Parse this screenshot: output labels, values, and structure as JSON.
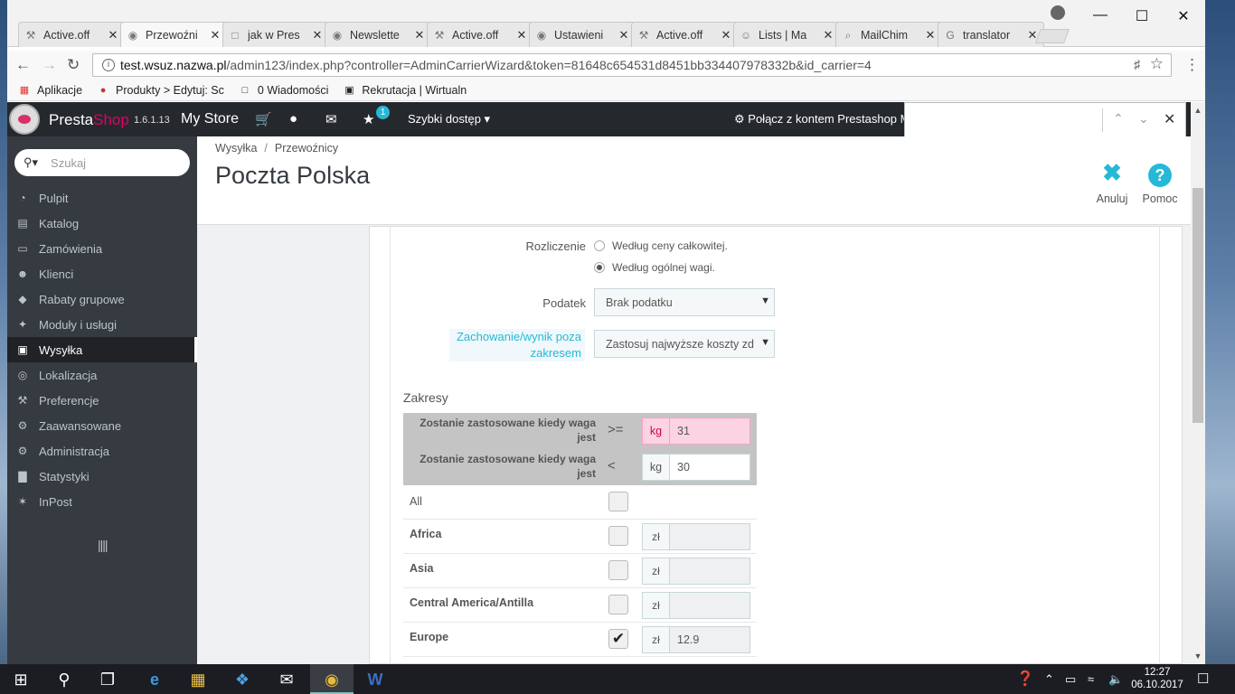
{
  "browser": {
    "tabs": [
      {
        "title": "Active.off",
        "icon": "tool-icon"
      },
      {
        "title": "Przewoźni",
        "icon": "prestashop-icon"
      },
      {
        "title": "jak w Pres",
        "icon": "page-icon"
      },
      {
        "title": "Newslette",
        "icon": "prestashop-icon"
      },
      {
        "title": "Active.off",
        "icon": "tool-icon"
      },
      {
        "title": "Ustawieni",
        "icon": "prestashop-icon"
      },
      {
        "title": "Active.off",
        "icon": "tool-icon"
      },
      {
        "title": "Lists | Ma",
        "icon": "mailchimp-icon"
      },
      {
        "title": "MailChim",
        "icon": "search-icon"
      },
      {
        "title": "translator",
        "icon": "google-icon"
      }
    ],
    "url_host": "test.wsuz.nazwa.pl",
    "url_path": "/admin123/index.php?controller=AdminCarrierWizard&token=81648c654531d8451bb334407978332b&id_carrier=4",
    "bookmarks": [
      {
        "label": "Aplikacje",
        "icon": "apps-icon"
      },
      {
        "label": "Produkty > Edytuj: Sc",
        "icon": "prestashop-icon"
      },
      {
        "label": "0 Wiadomości",
        "icon": "page-icon"
      },
      {
        "label": "Rekrutacja | Wirtualn",
        "icon": "building-icon"
      }
    ]
  },
  "topnav": {
    "brand_a": "Presta",
    "brand_b": "Shop",
    "version": "1.6.1.13",
    "store": "My Store",
    "notifications": "1",
    "quick_access": "Szybki dostęp",
    "connect": "Połącz z kontem Prestashop M"
  },
  "sidebar": {
    "search_placeholder": "Szukaj",
    "items": [
      {
        "label": "Pulpit",
        "icon": "dashboard-icon"
      },
      {
        "label": "Katalog",
        "icon": "book-icon"
      },
      {
        "label": "Zamówienia",
        "icon": "credit-card-icon"
      },
      {
        "label": "Klienci",
        "icon": "users-icon"
      },
      {
        "label": "Rabaty grupowe",
        "icon": "tag-icon"
      },
      {
        "label": "Moduły i usługi",
        "icon": "puzzle-icon"
      },
      {
        "label": "Wysyłka",
        "icon": "truck-icon"
      },
      {
        "label": "Lokalizacja",
        "icon": "globe-icon"
      },
      {
        "label": "Preferencje",
        "icon": "wrench-icon"
      },
      {
        "label": "Zaawansowane",
        "icon": "cogs-icon"
      },
      {
        "label": "Administracja",
        "icon": "gear-icon"
      },
      {
        "label": "Statystyki",
        "icon": "bar-chart-icon"
      },
      {
        "label": "InPost",
        "icon": "inpost-icon"
      }
    ],
    "active_index": 6
  },
  "header": {
    "breadcrumb": [
      "Wysyłka",
      "Przewoźnicy"
    ],
    "title": "Poczta Polska",
    "cancel_label": "Anuluj",
    "help_label": "Pomoc"
  },
  "form": {
    "billing_label": "Rozliczenie",
    "billing_options": [
      "Według ceny całkowitej.",
      "Według ogólnej wagi."
    ],
    "billing_selected": 1,
    "tax_label": "Podatek",
    "tax_value": "Brak podatku",
    "outofrange_label": "Zachowanie/wynik poza zakresem",
    "outofrange_value": "Zastosuj najwyższe koszty zd",
    "ranges_title": "Zakresy"
  },
  "ranges": [
    {
      "label": "Zostanie zastosowane kiedy waga jest",
      "operator": ">=",
      "unit": "kg",
      "value": "31",
      "invalid": true
    },
    {
      "label": "Zostanie zastosowane kiedy waga jest",
      "operator": "<",
      "unit": "kg",
      "value": "30",
      "invalid": false
    }
  ],
  "zones": [
    {
      "name": "All",
      "checked": false,
      "has_price": false
    },
    {
      "name": "Africa",
      "checked": false,
      "unit": "zł",
      "price": ""
    },
    {
      "name": "Asia",
      "checked": false,
      "unit": "zł",
      "price": ""
    },
    {
      "name": "Central America/Antilla",
      "checked": false,
      "unit": "zł",
      "price": ""
    },
    {
      "name": "Europe",
      "checked": true,
      "unit": "zł",
      "price": "12.9"
    }
  ],
  "taskbar": {
    "time": "12:27",
    "date": "06.10.2017"
  }
}
